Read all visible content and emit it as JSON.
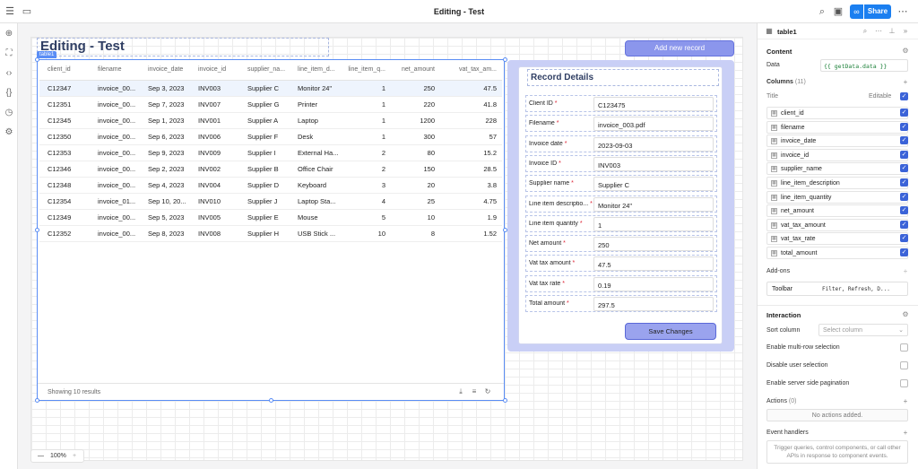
{
  "app": {
    "title": "Editing - Test",
    "share_label": "Share"
  },
  "page": {
    "title": "Editing - Test",
    "add_button": "Add new record",
    "table_tag": "table1"
  },
  "table": {
    "columns": [
      "client_id",
      "filename",
      "invoice_date",
      "invoice_id",
      "supplier_na...",
      "line_item_d...",
      "line_item_q...",
      "net_amount",
      "vat_tax_am..."
    ],
    "rows": [
      [
        "C12347",
        "invoice_00...",
        "Sep 3, 2023",
        "INV003",
        "Supplier C",
        "Monitor 24\"",
        "1",
        "250",
        "47.5"
      ],
      [
        "C12351",
        "invoice_00...",
        "Sep 7, 2023",
        "INV007",
        "Supplier G",
        "Printer",
        "1",
        "220",
        "41.8"
      ],
      [
        "C12345",
        "invoice_00...",
        "Sep 1, 2023",
        "INV001",
        "Supplier A",
        "Laptop",
        "1",
        "1200",
        "228"
      ],
      [
        "C12350",
        "invoice_00...",
        "Sep 6, 2023",
        "INV006",
        "Supplier F",
        "Desk",
        "1",
        "300",
        "57"
      ],
      [
        "C12353",
        "invoice_00...",
        "Sep 9, 2023",
        "INV009",
        "Supplier I",
        "External Ha...",
        "2",
        "80",
        "15.2"
      ],
      [
        "C12346",
        "invoice_00...",
        "Sep 2, 2023",
        "INV002",
        "Supplier B",
        "Office Chair",
        "2",
        "150",
        "28.5"
      ],
      [
        "C12348",
        "invoice_00...",
        "Sep 4, 2023",
        "INV004",
        "Supplier D",
        "Keyboard",
        "3",
        "20",
        "3.8"
      ],
      [
        "C12354",
        "invoice_01...",
        "Sep 10, 20...",
        "INV010",
        "Supplier J",
        "Laptop Sta...",
        "4",
        "25",
        "4.75"
      ],
      [
        "C12349",
        "invoice_00...",
        "Sep 5, 2023",
        "INV005",
        "Supplier E",
        "Mouse",
        "5",
        "10",
        "1.9"
      ],
      [
        "C12352",
        "invoice_00...",
        "Sep 8, 2023",
        "INV008",
        "Supplier H",
        "USB Stick ...",
        "10",
        "8",
        "1.52"
      ]
    ],
    "footer": "Showing 10 results"
  },
  "form": {
    "title": "Record Details",
    "fields": [
      {
        "label": "Client ID",
        "value": "C123475"
      },
      {
        "label": "Filename",
        "value": "invoice_003.pdf"
      },
      {
        "label": "Invoice date",
        "value": "2023-09-03"
      },
      {
        "label": "Invoice ID",
        "value": "INV003"
      },
      {
        "label": "Supplier name",
        "value": "Supplier C"
      },
      {
        "label": "Line item descriptio...",
        "value": "Monitor 24\""
      },
      {
        "label": "Line item quantity",
        "value": "1"
      },
      {
        "label": "Net amount",
        "value": "250"
      },
      {
        "label": "Vat tax amount",
        "value": "47.5"
      },
      {
        "label": "Vat tax rate",
        "value": "0.19"
      },
      {
        "label": "Total amount",
        "value": "297.5"
      }
    ],
    "save_label": "Save Changes"
  },
  "zoom": {
    "level": "100%",
    "minus": "—",
    "plus": "+"
  },
  "inspector": {
    "component": "table1",
    "content_label": "Content",
    "data_label": "Data",
    "data_value": "{{ getData.data }}",
    "columns_label": "Columns",
    "columns_count": "(11)",
    "title_label": "Title",
    "editable_label": "Editable",
    "columns": [
      "client_id",
      "filename",
      "invoice_date",
      "invoice_id",
      "supplier_name",
      "line_item_description",
      "line_item_quantity",
      "net_amount",
      "vat_tax_amount",
      "vat_tax_rate",
      "total_amount"
    ],
    "addons_label": "Add-ons",
    "toolbar_label": "Toolbar",
    "toolbar_value": "Filter, Refresh, D...",
    "interaction_label": "Interaction",
    "sort_label": "Sort column",
    "sort_placeholder": "Select column",
    "multirow_label": "Enable multi-row selection",
    "disable_sel_label": "Disable user selection",
    "pagination_label": "Enable server side pagination",
    "actions_label": "Actions",
    "actions_count": "(0)",
    "no_actions": "No actions added.",
    "events_label": "Event handlers",
    "events_hint": "Trigger queries, control components, or call other APIs in response to component events."
  },
  "icons": {
    "gear": "⚙",
    "search": "⌕",
    "more": "⋯",
    "pin": "📌",
    "plus": "+",
    "settings": "⚙",
    "expand": "»"
  }
}
